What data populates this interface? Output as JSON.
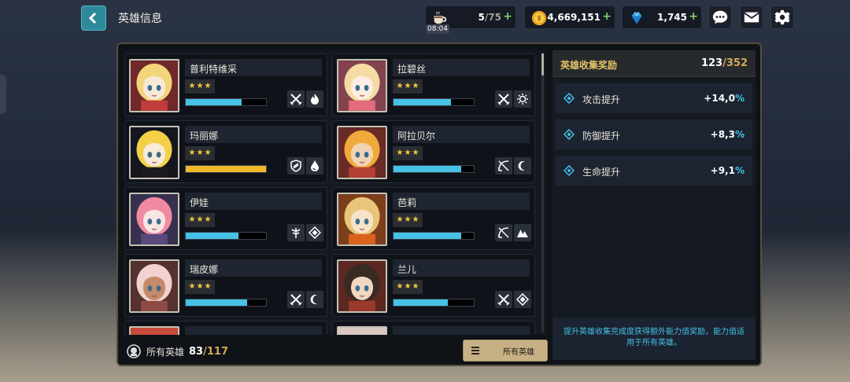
{
  "header": {
    "title": "英雄信息"
  },
  "resources": {
    "stamina": {
      "current": "5",
      "max": "/75",
      "timer": "08:04",
      "icon": "coffee-cup-icon"
    },
    "gold": {
      "value": "4,669,151",
      "icon": "gold-coin-icon"
    },
    "gems": {
      "value": "1,745",
      "icon": "blue-gem-icon"
    },
    "plus": "+"
  },
  "top_buttons": [
    "chat-icon",
    "mail-icon",
    "gear-icon"
  ],
  "heroes": [
    {
      "name": "普利特维采",
      "stars": 3,
      "progress": 0.7,
      "bar_color": "#45c2e6",
      "classes": [
        "crossed-swords-icon",
        "flame-icon"
      ],
      "palette": [
        "#f2d57a",
        "#c23b3b",
        "#f7e9d8"
      ]
    },
    {
      "name": "拉碧丝",
      "stars": 3,
      "progress": 0.72,
      "bar_color": "#45c2e6",
      "classes": [
        "crossed-swords-icon",
        "sun-icon"
      ],
      "palette": [
        "#f5dca4",
        "#e26b7c",
        "#fbeee2"
      ]
    },
    {
      "name": "玛丽娜",
      "stars": 3,
      "progress": 1.0,
      "bar_color": "#f0b92a",
      "classes": [
        "shield-icon",
        "water-drop-icon"
      ],
      "palette": [
        "#f4d049",
        "#1c1b22",
        "#f7ead6"
      ]
    },
    {
      "name": "阿拉贝尔",
      "stars": 3,
      "progress": 0.84,
      "bar_color": "#45c2e6",
      "classes": [
        "bow-icon",
        "moon-icon"
      ],
      "palette": [
        "#f0a93a",
        "#b43f32",
        "#f2d3b3"
      ]
    },
    {
      "name": "伊娃",
      "stars": 3,
      "progress": 0.66,
      "bar_color": "#45c2e6",
      "classes": [
        "staff-icon",
        "diamond-icon"
      ],
      "palette": [
        "#f08aa1",
        "#5a4a7c",
        "#f9e4e4"
      ]
    },
    {
      "name": "芭莉",
      "stars": 3,
      "progress": 0.84,
      "bar_color": "#45c2e6",
      "classes": [
        "bow-icon",
        "mountain-icon"
      ],
      "palette": [
        "#e9c57c",
        "#d9621e",
        "#f6e3c9"
      ]
    },
    {
      "name": "瑞皮娜",
      "stars": 3,
      "progress": 0.76,
      "bar_color": "#45c2e6",
      "classes": [
        "crossed-swords-icon",
        "moon-icon"
      ],
      "palette": [
        "#f3d1d0",
        "#8f4b43",
        "#c48a6a"
      ]
    },
    {
      "name": "兰儿",
      "stars": 3,
      "progress": 0.68,
      "bar_color": "#45c2e6",
      "classes": [
        "crossed-swords-icon",
        "diamond-icon"
      ],
      "palette": [
        "#3a2a24",
        "#9a3a2a",
        "#f1d6c0"
      ]
    }
  ],
  "footer": {
    "label": "所有英雄",
    "count": "83",
    "total": "/117",
    "filter_label": "所有英雄"
  },
  "rewards": {
    "title": "英雄收集奖励",
    "count": "123",
    "total": "/352",
    "stats": [
      {
        "label": "攻击提升",
        "value": "+14,0",
        "unit": "%"
      },
      {
        "label": "防御提升",
        "value": "+8,3",
        "unit": "%"
      },
      {
        "label": "生命提升",
        "value": "+9,1",
        "unit": "%"
      }
    ],
    "hint": "提升英雄收集完成度获得额外能力值奖励，能力值适用于所有英雄。"
  }
}
